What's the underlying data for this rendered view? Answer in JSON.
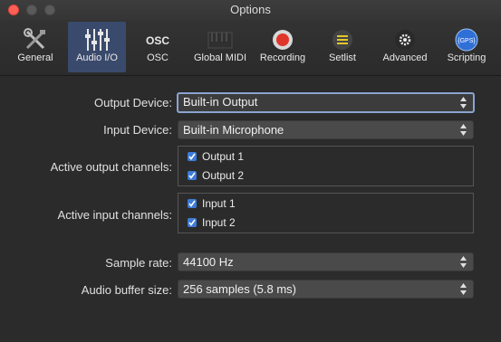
{
  "window": {
    "title": "Options"
  },
  "toolbar": {
    "tabs": [
      {
        "label": "General",
        "icon": "tools-icon"
      },
      {
        "label": "Audio I/O",
        "icon": "mixer-sliders-icon",
        "selected": true
      },
      {
        "label": "OSC",
        "icon": "osc-icon",
        "icon_text": "OSC"
      },
      {
        "label": "Global MIDI",
        "icon": "midi-keyboard-icon"
      },
      {
        "label": "Recording",
        "icon": "record-icon"
      },
      {
        "label": "Setlist",
        "icon": "setlist-icon"
      },
      {
        "label": "Advanced",
        "icon": "gear-icon"
      },
      {
        "label": "Scripting",
        "icon": "gps-script-icon",
        "icon_text": "{GPS}"
      }
    ]
  },
  "settings": {
    "output_device": {
      "label": "Output Device:",
      "value": "Built-in Output"
    },
    "input_device": {
      "label": "Input Device:",
      "value": "Built-in Microphone"
    },
    "active_output_channels": {
      "label": "Active output channels:",
      "channels": [
        "Output 1",
        "Output 2"
      ]
    },
    "active_input_channels": {
      "label": "Active input channels:",
      "channels": [
        "Input 1",
        "Input 2"
      ]
    },
    "sample_rate": {
      "label": "Sample rate:",
      "value": "44100 Hz"
    },
    "audio_buffer_size": {
      "label": "Audio buffer size:",
      "value": "256 samples (5.8 ms)"
    }
  },
  "colors": {
    "accent": "#3d7bd8",
    "selected_tab": "#3a4a6c",
    "record_red": "#e0352b",
    "setlist_yellow": "#e3c72a",
    "scripting_blue": "#2f6fd6"
  }
}
